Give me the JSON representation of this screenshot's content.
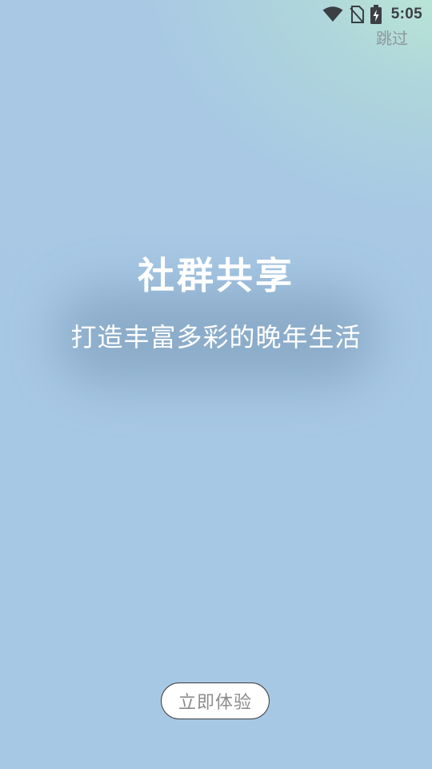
{
  "status_bar": {
    "time": "5:05",
    "icons": [
      "wifi-icon",
      "no-sim-icon",
      "battery-charging-icon"
    ]
  },
  "skip": {
    "label": "跳过"
  },
  "hero": {
    "title": "社群共享",
    "subtitle": "打造丰富多彩的晚年生活"
  },
  "cta": {
    "label": "立即体验"
  },
  "colors": {
    "background_top_right": "#bfe9d3",
    "background_main": "#a7c8e5",
    "status_text": "#3b3f44",
    "skip_text": "#8e969c",
    "cta_text": "#8b8b8b",
    "cta_border": "#3c3c3c"
  }
}
